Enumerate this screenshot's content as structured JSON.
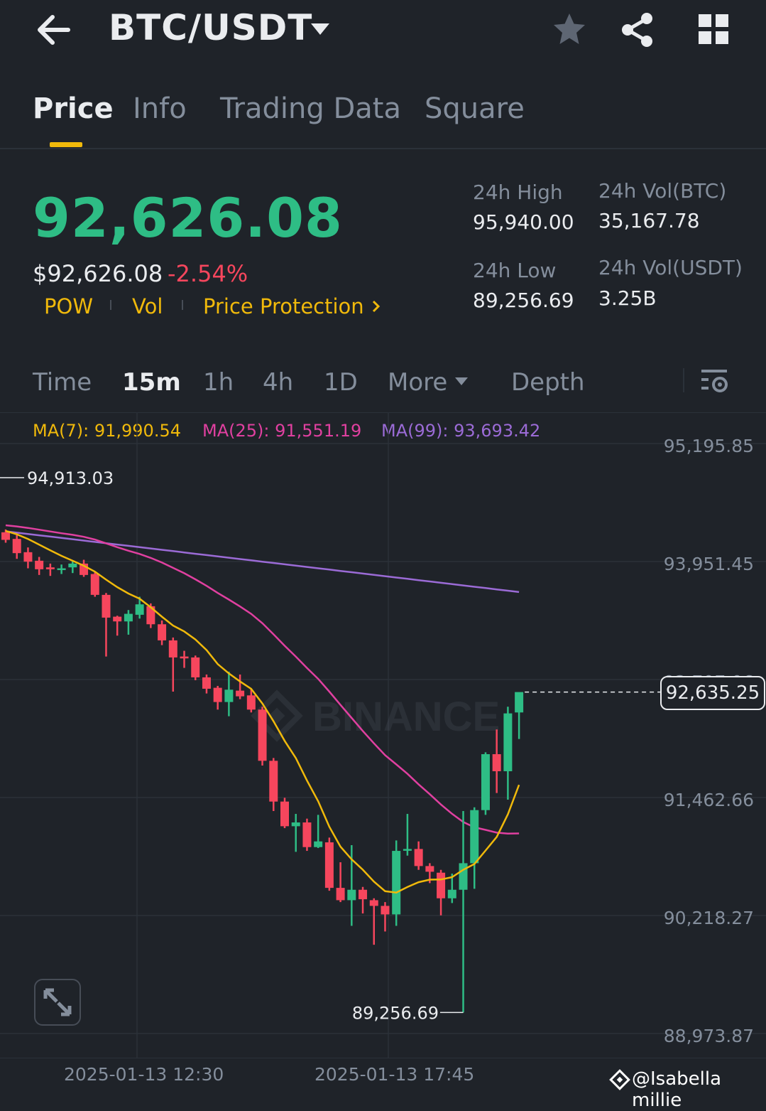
{
  "header": {
    "pair": "BTC/USDT",
    "back_icon": "arrow-left-icon",
    "favorite_icon": "star-icon",
    "share_icon": "share-icon",
    "more_icon": "grid-icon"
  },
  "tabs": [
    {
      "label": "Price",
      "active": true
    },
    {
      "label": "Info",
      "active": false
    },
    {
      "label": "Trading Data",
      "active": false
    },
    {
      "label": "Square",
      "active": false
    }
  ],
  "ticker": {
    "last_price": "92,626.08",
    "usd_price": "$92,626.08",
    "change_pct": "-2.54%",
    "tags": [
      "POW",
      "Vol",
      "Price Protection"
    ],
    "high_label": "24h High",
    "high_value": "95,940.00",
    "low_label": "24h Low",
    "low_value": "89,256.69",
    "vol_btc_label": "24h Vol(BTC)",
    "vol_btc_value": "35,167.78",
    "vol_usdt_label": "24h Vol(USDT)",
    "vol_usdt_value": "3.25B"
  },
  "intervals": [
    {
      "label": "Time",
      "active": false
    },
    {
      "label": "15m",
      "active": true
    },
    {
      "label": "1h",
      "active": false
    },
    {
      "label": "4h",
      "active": false
    },
    {
      "label": "1D",
      "active": false
    },
    {
      "label": "More",
      "active": false
    },
    {
      "label": "Depth",
      "active": false
    }
  ],
  "ma_legend": {
    "ma7": "MA(7): 91,990.54",
    "ma25": "MA(25): 91,551.19",
    "ma99": "MA(99): 93,693.42"
  },
  "colors": {
    "up": "#2ebd85",
    "down": "#f6465d",
    "ma7": "#f0b90b",
    "ma25": "#e040a0",
    "ma99": "#9b6bd6",
    "accent": "#f0b90b"
  },
  "chart_data": {
    "type": "candlestick",
    "y_ticks": [
      "95,195.85",
      "93,951.45",
      "92,707.06",
      "91,462.66",
      "90,218.27",
      "88,973.87"
    ],
    "ylim": [
      88973.87,
      95195.85
    ],
    "x_ticks": [
      "2025-01-13 12:30",
      "2025-01-13 17:45"
    ],
    "high_marker": "94,913.03",
    "low_marker": "89,256.69",
    "current_price_tag": "92,635.25",
    "watermark": "BINANCE",
    "candles": [
      {
        "o": 94320,
        "c": 94240,
        "h": 94350,
        "l": 94210
      },
      {
        "o": 94250,
        "c": 94100,
        "h": 94290,
        "l": 94040
      },
      {
        "o": 94110,
        "c": 94010,
        "h": 94160,
        "l": 93940
      },
      {
        "o": 94020,
        "c": 93930,
        "h": 94060,
        "l": 93870
      },
      {
        "o": 93950,
        "c": 93930,
        "h": 93990,
        "l": 93860
      },
      {
        "o": 93940,
        "c": 93940,
        "h": 93980,
        "l": 93880
      },
      {
        "o": 93950,
        "c": 93990,
        "h": 94020,
        "l": 93890
      },
      {
        "o": 93990,
        "c": 93870,
        "h": 94030,
        "l": 93850
      },
      {
        "o": 93880,
        "c": 93660,
        "h": 93900,
        "l": 93640
      },
      {
        "o": 93660,
        "c": 93420,
        "h": 93680,
        "l": 93010
      },
      {
        "o": 93430,
        "c": 93380,
        "h": 93440,
        "l": 93230
      },
      {
        "o": 93380,
        "c": 93460,
        "h": 93500,
        "l": 93240
      },
      {
        "o": 93450,
        "c": 93560,
        "h": 93640,
        "l": 93410
      },
      {
        "o": 93540,
        "c": 93350,
        "h": 93570,
        "l": 93310
      },
      {
        "o": 93350,
        "c": 93180,
        "h": 93390,
        "l": 93130
      },
      {
        "o": 93180,
        "c": 93000,
        "h": 93210,
        "l": 92640
      },
      {
        "o": 93010,
        "c": 92990,
        "h": 93070,
        "l": 92890
      },
      {
        "o": 93000,
        "c": 92790,
        "h": 93020,
        "l": 92760
      },
      {
        "o": 92790,
        "c": 92670,
        "h": 92820,
        "l": 92620
      },
      {
        "o": 92680,
        "c": 92530,
        "h": 92700,
        "l": 92450
      },
      {
        "o": 92530,
        "c": 92660,
        "h": 92850,
        "l": 92380
      },
      {
        "o": 92650,
        "c": 92590,
        "h": 92820,
        "l": 92560
      },
      {
        "o": 92600,
        "c": 92450,
        "h": 92670,
        "l": 92420
      },
      {
        "o": 92450,
        "c": 91910,
        "h": 92480,
        "l": 91860
      },
      {
        "o": 91910,
        "c": 91480,
        "h": 91940,
        "l": 91380
      },
      {
        "o": 91480,
        "c": 91220,
        "h": 91520,
        "l": 91200
      },
      {
        "o": 91220,
        "c": 91260,
        "h": 91350,
        "l": 90950
      },
      {
        "o": 91260,
        "c": 91000,
        "h": 91300,
        "l": 90960
      },
      {
        "o": 91000,
        "c": 91060,
        "h": 91340,
        "l": 90990
      },
      {
        "o": 91050,
        "c": 90570,
        "h": 91100,
        "l": 90540
      },
      {
        "o": 90570,
        "c": 90440,
        "h": 90840,
        "l": 90420
      },
      {
        "o": 90440,
        "c": 90550,
        "h": 91020,
        "l": 90170
      },
      {
        "o": 90550,
        "c": 90450,
        "h": 90580,
        "l": 90300
      },
      {
        "o": 90440,
        "c": 90380,
        "h": 90460,
        "l": 89970
      },
      {
        "o": 90380,
        "c": 90290,
        "h": 90420,
        "l": 90110
      },
      {
        "o": 90290,
        "c": 90960,
        "h": 91070,
        "l": 90170
      },
      {
        "o": 90970,
        "c": 90980,
        "h": 91350,
        "l": 90910
      },
      {
        "o": 90980,
        "c": 90800,
        "h": 91060,
        "l": 90760
      },
      {
        "o": 90800,
        "c": 90740,
        "h": 90830,
        "l": 90620
      },
      {
        "o": 90730,
        "c": 90460,
        "h": 90760,
        "l": 90280
      },
      {
        "o": 90460,
        "c": 90550,
        "h": 90720,
        "l": 90410
      },
      {
        "o": 90550,
        "c": 90830,
        "h": 91380,
        "l": 89256
      },
      {
        "o": 90830,
        "c": 91390,
        "h": 91420,
        "l": 90560
      },
      {
        "o": 91390,
        "c": 91980,
        "h": 92000,
        "l": 91340
      },
      {
        "o": 91980,
        "c": 91800,
        "h": 92240,
        "l": 91570
      },
      {
        "o": 91800,
        "c": 92410,
        "h": 92480,
        "l": 91500
      },
      {
        "o": 92420,
        "c": 92635,
        "h": 92440,
        "l": 92140
      }
    ]
  }
}
